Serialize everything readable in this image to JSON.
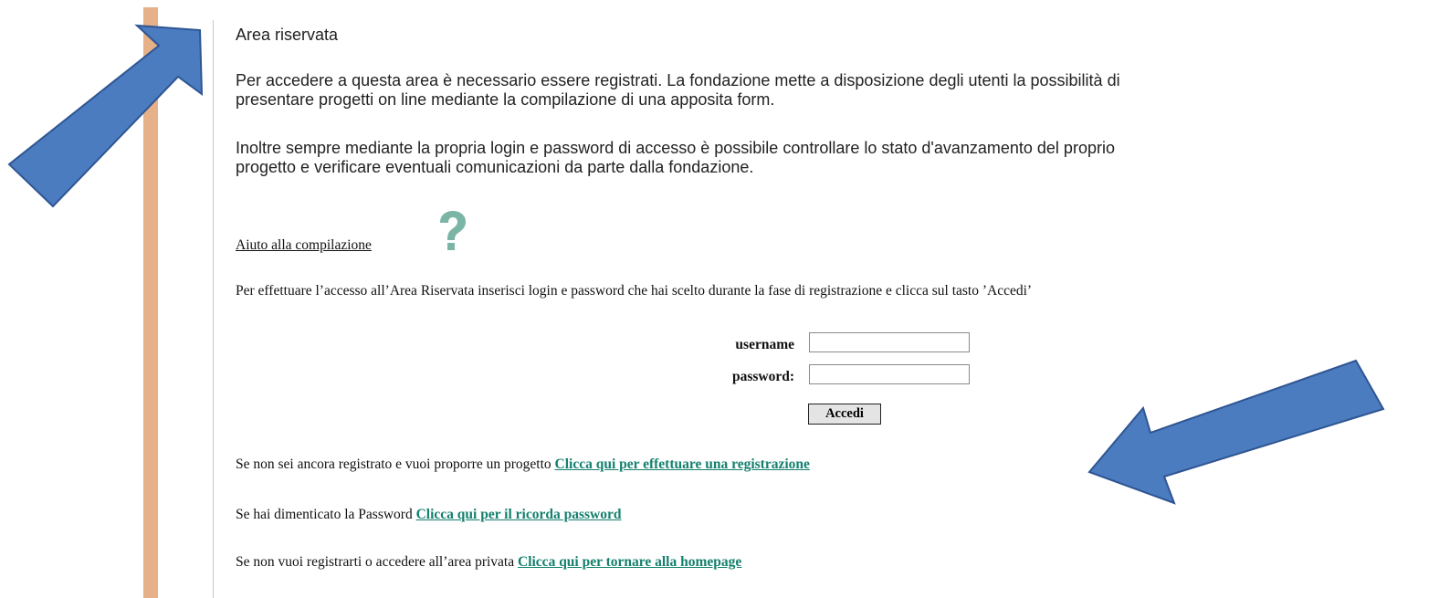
{
  "content": {
    "title": "Area riservata",
    "para1_line1": "Per accedere a questa area è necessario essere registrati. La fondazione mette a disposizione degli utenti la possibilità di",
    "para1_line2": "presentare progetti on line mediante la compilazione di una apposita form.",
    "para2_line1": "Inoltre sempre mediante la propria login e password di accesso è possibile controllare lo stato d'avanzamento del proprio",
    "para2_line2": "progetto e verificare eventuali comunicazioni da parte dalla fondazione.",
    "help_link": "Aiuto alla compilazione",
    "help_icon": "question-mark-icon",
    "intro": "Per effettuare l’accesso all’Area Riservata inserisci login e password che hai scelto durante la fase di registrazione e clicca sul tasto ’Accedi’"
  },
  "login": {
    "username_label": "username",
    "username_value": "",
    "password_label": "password:",
    "password_value": "",
    "submit_label": "Accedi"
  },
  "links": [
    {
      "prefix": "Se non sei ancora registrato e vuoi proporre un progetto ",
      "link": "Clicca qui per effettuare una registrazione"
    },
    {
      "prefix": "Se hai dimenticato la Password ",
      "link": "Clicca qui per il ricorda password"
    },
    {
      "prefix": "Se non vuoi registrarti o accedere all’area privata ",
      "link": "Clicca qui per tornare alla homepage"
    }
  ],
  "colors": {
    "sidebar": "#e6b088",
    "link": "#14806e",
    "arrow_fill": "#4a7cbf",
    "arrow_stroke": "#2f5593"
  },
  "annotations": [
    "arrow-icon",
    "arrow-icon"
  ]
}
